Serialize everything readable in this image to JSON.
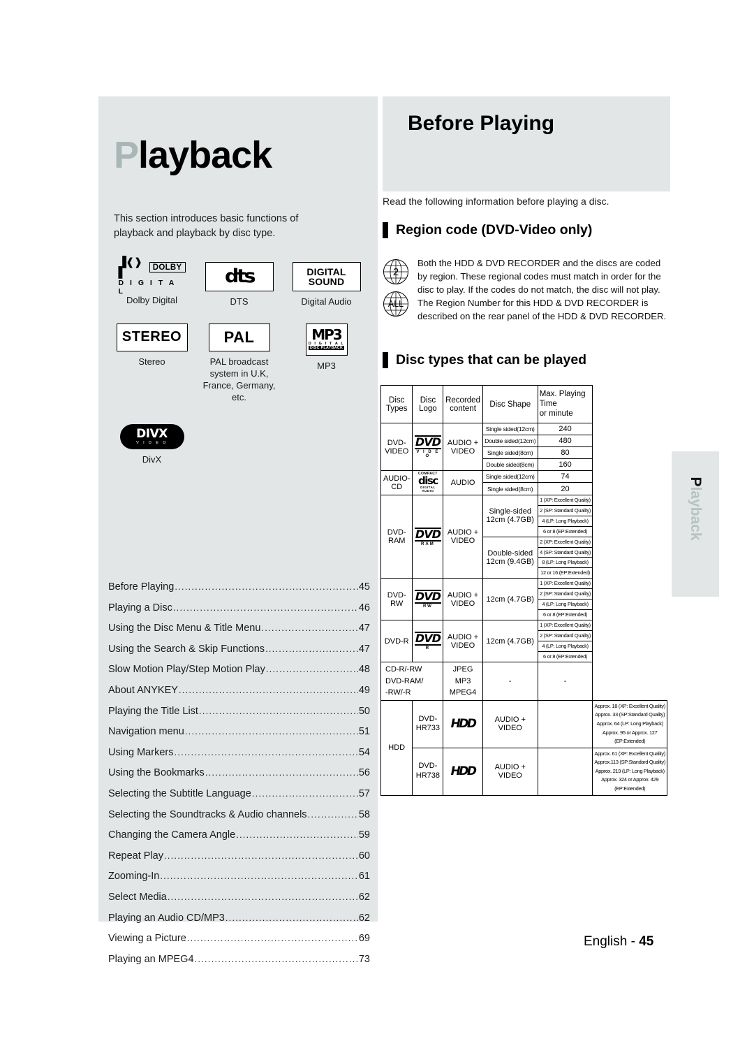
{
  "chapter": {
    "title_cap": "P",
    "title_rest": "layback",
    "intro": "This section introduces basic functions of playback and playback by disc type."
  },
  "logos": [
    {
      "name": "dolby-digital-logo",
      "caption": "Dolby Digital",
      "marks": {
        "box": "DOLBY",
        "bottom": "D I G I T A L"
      }
    },
    {
      "name": "dts-logo",
      "caption": "DTS",
      "marks": {
        "text": "dts"
      }
    },
    {
      "name": "digital-audio-logo",
      "caption": "Digital Audio",
      "marks": {
        "line1": "DIGITAL",
        "line2": "SOUND"
      }
    },
    {
      "name": "stereo-logo",
      "caption": "Stereo",
      "marks": {
        "text": "STEREO"
      }
    },
    {
      "name": "pal-logo",
      "caption": "PAL broadcast system in U.K, France, Germany, etc.",
      "marks": {
        "text": "PAL"
      }
    },
    {
      "name": "mp3-logo",
      "caption": "MP3",
      "marks": {
        "big": "MP3",
        "digital": "D I G I T A L",
        "playback": "DISC PLAYBACK"
      }
    },
    {
      "name": "divx-logo",
      "caption": "DivX",
      "marks": {
        "big": "DIVX",
        "small": "V I D E O"
      }
    }
  ],
  "toc": [
    {
      "label": "Before Playing",
      "page": "45"
    },
    {
      "label": "Playing a Disc",
      "page": "46"
    },
    {
      "label": "Using the Disc Menu & Title Menu",
      "page": "47"
    },
    {
      "label": "Using the Search & Skip Functions",
      "page": "47"
    },
    {
      "label": "Slow Motion Play/Step Motion Play",
      "page": "48"
    },
    {
      "label": "About ANYKEY",
      "page": "49"
    },
    {
      "label": "Playing the Title List",
      "page": "50"
    },
    {
      "label": "Navigation menu",
      "page": "51"
    },
    {
      "label": "Using Markers",
      "page": "54"
    },
    {
      "label": "Using the Bookmarks",
      "page": "56"
    },
    {
      "label": "Selecting the Subtitle Language",
      "page": "57"
    },
    {
      "label": "Selecting the Soundtracks & Audio channels",
      "page": "58"
    },
    {
      "label": "Changing the Camera Angle",
      "page": "59"
    },
    {
      "label": "Repeat Play",
      "page": "60"
    },
    {
      "label": "Zooming-In",
      "page": "61"
    },
    {
      "label": "Select Media",
      "page": "62"
    },
    {
      "label": "Playing an Audio CD/MP3",
      "page": "62"
    },
    {
      "label": "Viewing a Picture",
      "page": "69"
    },
    {
      "label": "Playing an MPEG4",
      "page": "73"
    }
  ],
  "right": {
    "header_title": "Before Playing",
    "lead": "Read the following information before playing a disc.",
    "section_region": "Region code (DVD-Video only)",
    "section_disc": "Disc types that can be played",
    "region_globe_2": "2",
    "region_globe_all": "ALL",
    "region_text": "Both the HDD & DVD RECORDER and the discs are coded by region. These regional codes must match in order for the disc to play. If the codes do not match, the disc will not play. The Region Number for this HDD & DVD RECORDER is described on the rear panel of the HDD & DVD RECORDER."
  },
  "table": {
    "headers": [
      "Disc Types",
      "Disc Logo",
      "Recorded content",
      "Disc Shape",
      "Max. Playing Time or minute"
    ],
    "header_time_line1": "Max. Playing Time",
    "header_time_line2": "or minute",
    "rows": {
      "dvd_video": {
        "type": "DVD-VIDEO",
        "logo_word": "DVD",
        "logo_sub": "V I D E O",
        "content": "AUDIO + VIDEO",
        "shapes": [
          "Single sided(12cm)",
          "Double sided(12cm)",
          "Single sided(8cm)",
          "Double sided(8cm)"
        ],
        "times": [
          "240",
          "480",
          "80",
          "160"
        ]
      },
      "audio_cd": {
        "type": "AUDIO-CD",
        "logo_top": "COMPACT",
        "logo_mid": "disc",
        "logo_bot": "DIGITAL AUDIO",
        "content": "AUDIO",
        "shapes": [
          "Single sided(12cm)",
          "Single sided(8cm)"
        ],
        "times": [
          "74",
          "20"
        ]
      },
      "dvd_ram": {
        "type": "DVD-RAM",
        "logo_word": "DVD",
        "logo_sub": "RAM",
        "content": "AUDIO + VIDEO",
        "groups": [
          {
            "shape_l1": "Single-sided",
            "shape_l2": "12cm (4.7GB)",
            "times": [
              "1 (XP: Excellent Quality)",
              "2 (SP: Standard Quality)",
              "4 (LP: Long Playback)",
              "6 or 8 (EP:Extended)"
            ]
          },
          {
            "shape_l1": "Double-sided",
            "shape_l2": "12cm (9.4GB)",
            "times": [
              "2 (XP: Excellent Quality)",
              "4 (SP: Standard Quality)",
              "8 (LP: Long Playback)",
              "12 or 16 (EP:Extended)"
            ]
          }
        ]
      },
      "dvd_rw": {
        "type": "DVD-RW",
        "logo_word": "DVD",
        "logo_sub": "RW",
        "content": "AUDIO + VIDEO",
        "shape": "12cm (4.7GB)",
        "times": [
          "1 (XP: Excellent Quality)",
          "2 (SP: Standard Quality)",
          "4 (LP: Long Playback)",
          "6 or 8 (EP:Extended)"
        ]
      },
      "dvd_r": {
        "type": "DVD-R",
        "logo_word": "DVD",
        "logo_sub": "R",
        "content": "AUDIO + VIDEO",
        "shape": "12cm (4.7GB)",
        "times": [
          "1 (XP: Excellent Quality)",
          "2 (SP: Standard Quality)",
          "4 (LP: Long Playback)",
          "6 or 8 (EP:Extended)"
        ]
      },
      "cd_r_rw": {
        "type_l1": "CD-R/-RW",
        "type_l2": "DVD-RAM/",
        "type_l3": "-RW/-R",
        "content_l1": "JPEG",
        "content_l2": "MP3",
        "content_l3": "MPEG4",
        "shape": "-",
        "time": "-"
      },
      "hdd": {
        "type": "HDD",
        "sub1_l1": "DVD-",
        "sub1_l2": "HR733",
        "sub2_l1": "DVD-",
        "sub2_l2": "HR738",
        "logo": "HDD",
        "content": "AUDIO + VIDEO",
        "times_733": [
          "Approx. 18 (XP: Excellent Quality)",
          "Approx. 33 (SP:Standard Quality)",
          "Approx. 64 (LP: Long Playback)",
          "Approx. 95 or Approx. 127",
          "(EP:Extended)"
        ],
        "times_738": [
          "Approx. 61 (XP: Excellent Quality)",
          "Approx.113 (SP:Standard Quality)",
          "Approx. 219 (LP: Long Playback)",
          "Approx. 324 or Approx. 429",
          "(EP:Extended)"
        ]
      }
    }
  },
  "footer": {
    "lang": "English - ",
    "page": "45"
  },
  "side_tab": {
    "cap": "P",
    "rest": "layback"
  }
}
